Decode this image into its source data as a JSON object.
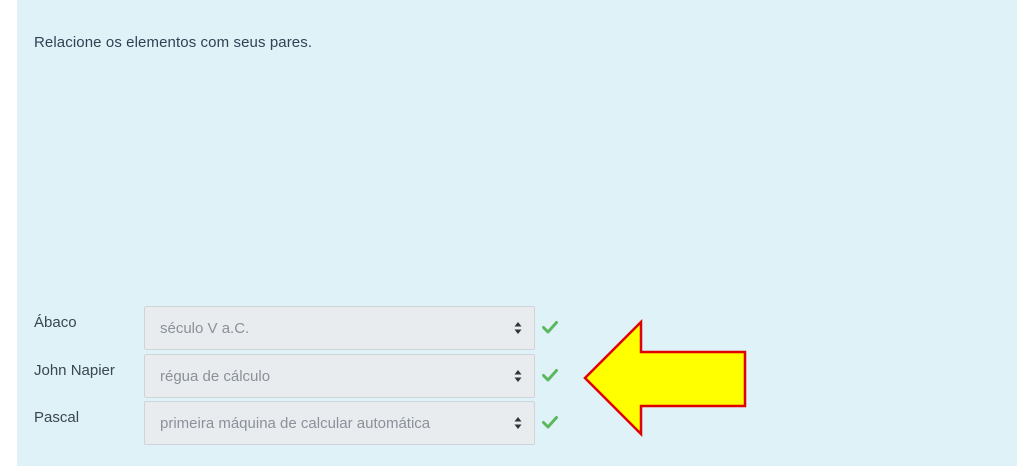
{
  "question": {
    "prompt": "Relacione os elementos com seus pares."
  },
  "rows": [
    {
      "label": "Ábaco",
      "selected": "século V a.C.",
      "status_icon": "check-icon",
      "status_color": "#5cb85c"
    },
    {
      "label": "John Napier",
      "selected": "régua de cálculo",
      "status_icon": "check-icon",
      "status_color": "#5cb85c"
    },
    {
      "label": "Pascal",
      "selected": "primeira máquina de calcular automática",
      "status_icon": "check-icon",
      "status_color": "#5cb85c"
    }
  ],
  "annotation": {
    "icon": "arrow-left-icon",
    "fill": "#ffff00",
    "stroke": "#e00000"
  },
  "colors": {
    "panel_background": "#def2f8",
    "select_background": "#e9ecef"
  }
}
